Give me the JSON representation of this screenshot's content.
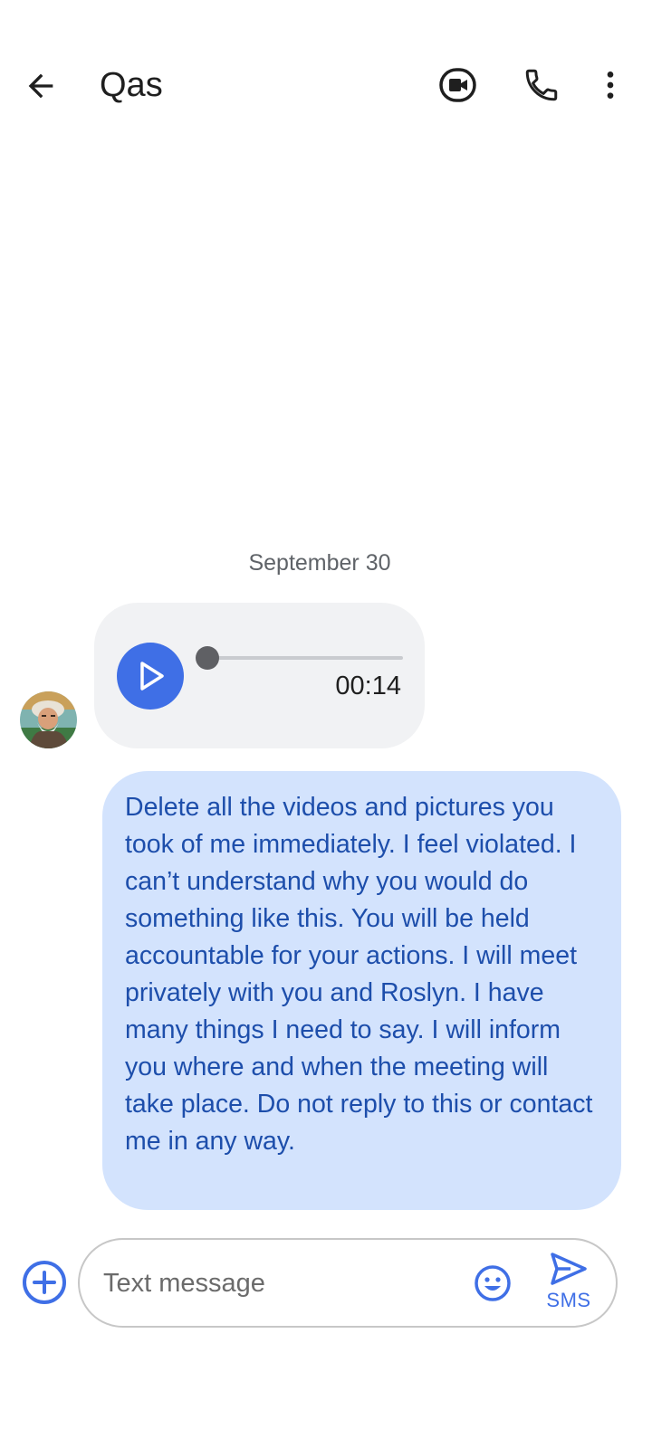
{
  "header": {
    "contact_name": "Qas",
    "icons": {
      "back": "arrow-back-icon",
      "video": "video-call-icon",
      "call": "phone-icon",
      "more": "more-vert-icon"
    }
  },
  "conversation": {
    "date_label": "September 30",
    "incoming_audio": {
      "duration": "00:14",
      "progress": 0
    },
    "outgoing_message": {
      "text": "Delete all the videos and pictures you took of me immediately. I feel violated. I can’t understand why you would do something like this. You will be held accountable for your actions. I will meet privately with you and Roslyn. I have many things I need to say. I will inform you where and when the meeting will take place. Do not reply to this or contact me in any way."
    }
  },
  "composer": {
    "placeholder": "Text message",
    "send_label": "SMS",
    "icons": {
      "attach": "add-circle-icon",
      "emoji": "emoji-icon",
      "send": "send-icon"
    }
  },
  "colors": {
    "accent": "#3f6fe6",
    "outgoing_bubble": "#d3e3fd",
    "outgoing_text": "#1d4eab",
    "incoming_bubble": "#f1f2f4"
  }
}
